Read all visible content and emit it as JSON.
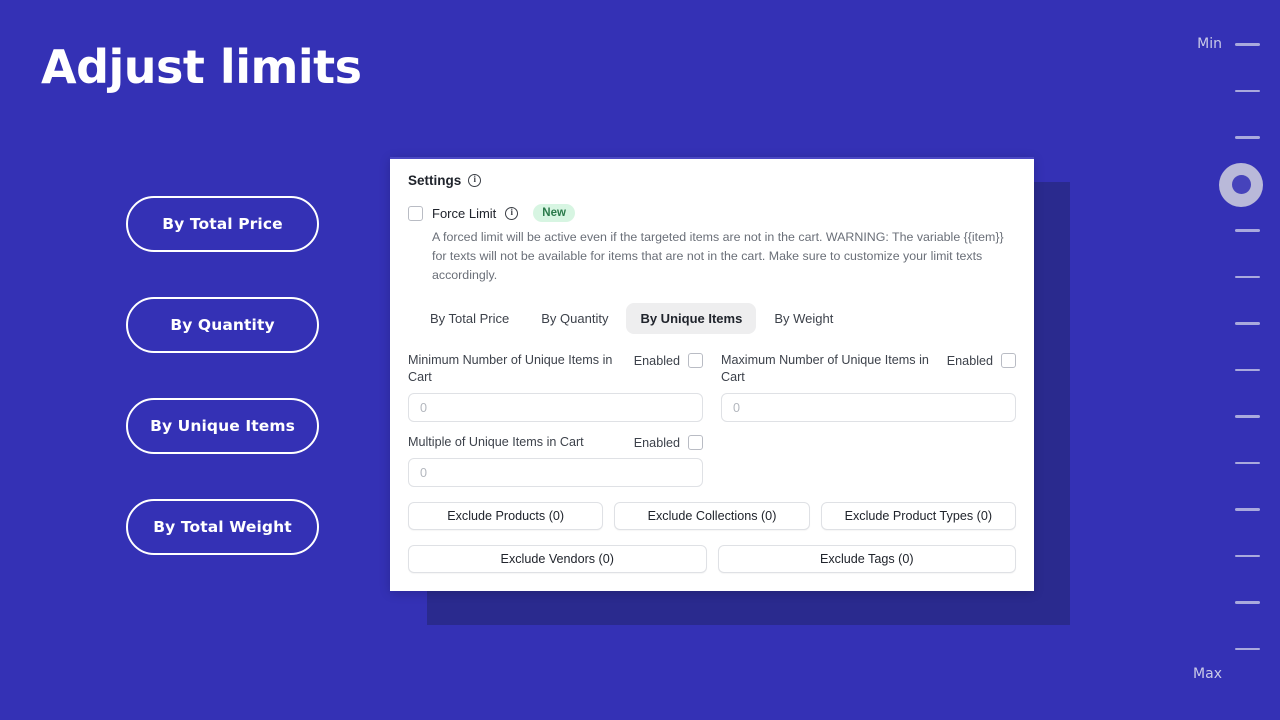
{
  "page": {
    "title": "Adjust limits",
    "background_color": "#3431b5",
    "panel_shadow_color": "#2a2a8e"
  },
  "pills": [
    {
      "label": "By Total Price"
    },
    {
      "label": "By Quantity"
    },
    {
      "label": "By Unique Items"
    },
    {
      "label": "By Total Weight"
    }
  ],
  "card": {
    "header": {
      "title": "Settings",
      "info_icon": "info-icon"
    },
    "force_limit": {
      "label": "Force Limit",
      "info_icon": "info-icon",
      "badge": "New",
      "badge_bg": "#d7f5e2",
      "badge_color": "#2b7a4b",
      "checked": false,
      "description": "A forced limit will be active even if the targeted items are not in the cart. WARNING: The variable {{item}} for texts will not be available for items that are not in the cart. Make sure to customize your limit texts accordingly."
    },
    "tabs": [
      {
        "label": "By Total Price",
        "active": false
      },
      {
        "label": "By Quantity",
        "active": false
      },
      {
        "label": "By Unique Items",
        "active": true
      },
      {
        "label": "By Weight",
        "active": false
      }
    ],
    "active_tab": "By Unique Items",
    "fields": [
      {
        "label": "Minimum Number of Unique Items in Cart",
        "enabled_label": "Enabled",
        "enabled": false,
        "value": "",
        "placeholder": "0"
      },
      {
        "label": "Maximum Number of Unique Items in Cart",
        "enabled_label": "Enabled",
        "enabled": false,
        "value": "",
        "placeholder": "0"
      },
      {
        "label": "Multiple of Unique Items in Cart",
        "enabled_label": "Enabled",
        "enabled": false,
        "value": "",
        "placeholder": "0"
      }
    ],
    "exclude_buttons_row1": [
      {
        "label": "Exclude Products (0)"
      },
      {
        "label": "Exclude Collections (0)"
      },
      {
        "label": "Exclude Product Types (0)"
      }
    ],
    "exclude_buttons_row2": [
      {
        "label": "Exclude Vendors (0)"
      },
      {
        "label": "Exclude Tags (0)"
      }
    ]
  },
  "slider": {
    "min_label": "Min",
    "max_label": "Max",
    "tick_count": 14,
    "handle_position_index": 3,
    "handle_color": "#b9b9d9",
    "tick_color": "#a9a9dd"
  }
}
